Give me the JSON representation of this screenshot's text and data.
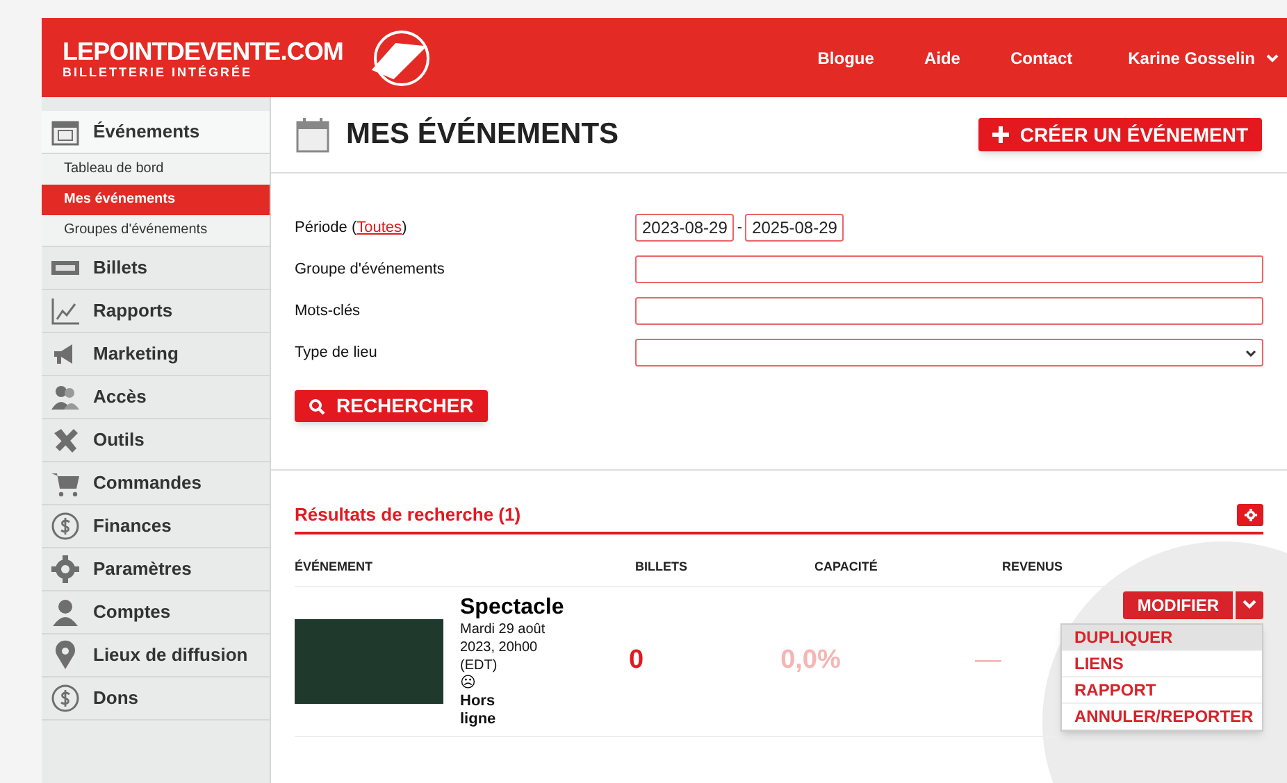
{
  "header": {
    "logo_title": "LEPOINTDEVENTE.COM",
    "logo_subtitle": "BILLETTERIE INTÉGRÉE",
    "nav": [
      "Blogue",
      "Aide",
      "Contact"
    ],
    "user": "Karine Gosselin"
  },
  "sidebar": {
    "items": [
      {
        "label": "Événements",
        "expanded": true,
        "children": [
          {
            "label": "Tableau de bord",
            "selected": false
          },
          {
            "label": "Mes événements",
            "selected": true
          },
          {
            "label": "Groupes d'événements",
            "selected": false
          }
        ]
      },
      {
        "label": "Billets",
        "expanded": false
      },
      {
        "label": "Rapports",
        "expanded": false
      },
      {
        "label": "Marketing",
        "expanded": false
      },
      {
        "label": "Accès",
        "expanded": false
      },
      {
        "label": "Outils",
        "expanded": false
      },
      {
        "label": "Commandes",
        "expanded": false
      },
      {
        "label": "Finances",
        "expanded": false
      },
      {
        "label": "Paramètres",
        "expanded": false
      },
      {
        "label": "Comptes",
        "expanded": false
      },
      {
        "label": "Lieux de diffusion",
        "expanded": false
      },
      {
        "label": "Dons",
        "expanded": false
      }
    ]
  },
  "page": {
    "title": "MES ÉVÉNEMENTS",
    "create_button": "CRÉER UN ÉVÉNEMENT"
  },
  "form": {
    "period_label": "Période (",
    "period_link": "Toutes",
    "period_close": ")",
    "date_from": "2023-08-29",
    "date_separator": "-",
    "date_to": "2025-08-29",
    "fields": [
      {
        "label": "Groupe d'événements",
        "kind": "text"
      },
      {
        "label": "Mots-clés",
        "kind": "text"
      },
      {
        "label": "Type de lieu",
        "kind": "select"
      }
    ],
    "search_button": "RECHERCHER"
  },
  "results": {
    "title": "Résultats de recherche (1)",
    "columns": [
      "ÉVÉNEMENT",
      "BILLETS",
      "CAPACITÉ",
      "REVENUS"
    ],
    "rows": [
      {
        "name": "Spectacle",
        "date": "Mardi 29 août 2023, 20h00 (EDT)",
        "status_icon": "☹",
        "status": "Hors ligne",
        "tickets": "0",
        "capacity": "0,0%",
        "revenue": "—",
        "action": "MODIFIER",
        "menu": [
          {
            "label": "DUPLIQUER",
            "selected": true
          },
          {
            "label": "LIENS",
            "selected": false
          },
          {
            "label": "RAPPORT",
            "selected": false
          },
          {
            "label": "ANNULER/REPORTER",
            "selected": false
          }
        ]
      }
    ]
  }
}
